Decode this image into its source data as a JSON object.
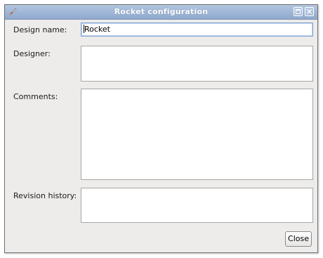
{
  "window": {
    "title": "Rocket configuration"
  },
  "form": {
    "design_name_label": "Design name:",
    "design_name_value": "Rocket",
    "designer_label": "Designer:",
    "designer_value": "",
    "comments_label": "Comments:",
    "comments_value": "",
    "revision_history_label": "Revision history:",
    "revision_history_value": ""
  },
  "buttons": {
    "close_label": "Close"
  },
  "colors": {
    "titlebar": "#9fb6d7",
    "window_bg": "#edeceb",
    "field_bg": "#ffffff"
  },
  "icons": {
    "app": "rocket-icon",
    "maximize": "maximize-icon",
    "close": "close-icon"
  }
}
